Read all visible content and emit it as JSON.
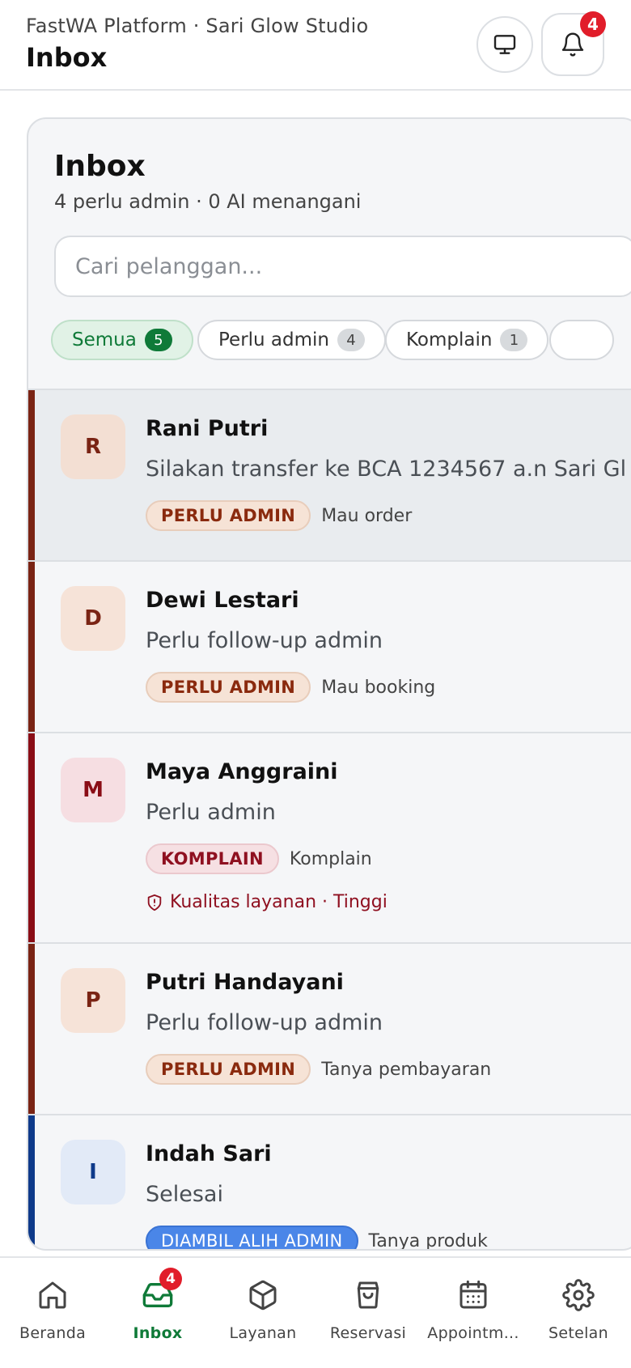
{
  "header": {
    "subtitle": "FastWA Platform · Sari Glow Studio",
    "title": "Inbox",
    "notification_count": "4"
  },
  "inbox": {
    "title": "Inbox",
    "summary": "4 perlu admin · 0 AI menangani",
    "search_placeholder": "Cari pelanggan...",
    "filters": [
      {
        "label": "Semua",
        "count": "5",
        "active": true
      },
      {
        "label": "Perlu admin",
        "count": "4"
      },
      {
        "label": "Komplain",
        "count": "1"
      }
    ],
    "conversations": [
      {
        "initial": "R",
        "name": "Rani Putri",
        "preview": "Silakan transfer ke BCA 1234567 a.n Sari Gl",
        "tag": "PERLU ADMIN",
        "reason": "Mau order",
        "bar_color": "#7a2414"
      },
      {
        "initial": "D",
        "name": "Dewi Lestari",
        "preview": "Perlu follow-up admin",
        "tag": "PERLU ADMIN",
        "reason": "Mau booking",
        "bar_color": "#7a2414"
      },
      {
        "initial": "M",
        "name": "Maya Anggraini",
        "preview": "Perlu admin",
        "tag": "KOMPLAIN",
        "reason": "Komplain",
        "risk": "Kualitas layanan · Tinggi",
        "bar_color": "#8a0d16"
      },
      {
        "initial": "P",
        "name": "Putri Handayani",
        "preview": "Perlu follow-up admin",
        "tag": "PERLU ADMIN",
        "reason": "Tanya pembayaran",
        "bar_color": "#7a2414"
      },
      {
        "initial": "I",
        "name": "Indah Sari",
        "preview": "Selesai",
        "tag": "DIAMBIL ALIH ADMIN",
        "reason": "Tanya produk",
        "bar_color": "#0e3a8a"
      }
    ]
  },
  "nav": {
    "items": [
      {
        "label": "Beranda",
        "icon": "home-icon"
      },
      {
        "label": "Inbox",
        "icon": "inbox-icon",
        "badge": "4",
        "active": true
      },
      {
        "label": "Layanan",
        "icon": "box-icon"
      },
      {
        "label": "Reservasi",
        "icon": "shopping-bag-icon"
      },
      {
        "label": "Appointm...",
        "icon": "calendar-icon"
      },
      {
        "label": "Setelan",
        "icon": "gear-icon"
      }
    ]
  },
  "colors": {
    "accent": "#0f7a38",
    "alert": "#e11d2a",
    "admin_bar": "#7a2414",
    "complaint_bar": "#8a0d16",
    "taken_bar": "#0e3a8a"
  }
}
